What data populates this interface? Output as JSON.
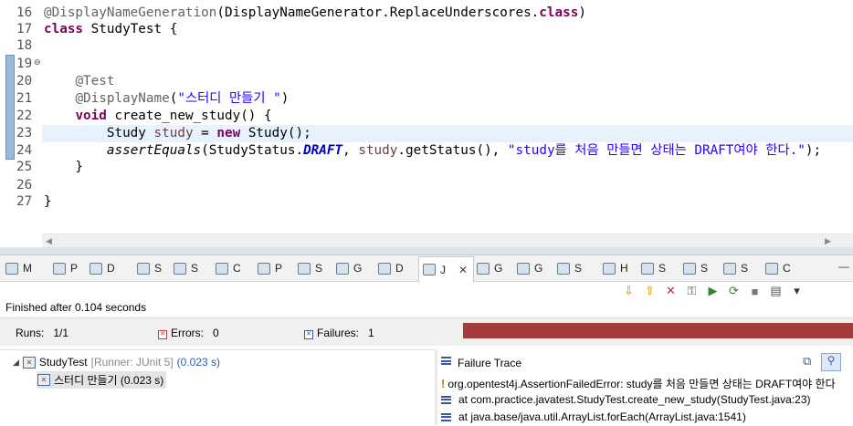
{
  "editor": {
    "lines": [
      {
        "n": "16",
        "tokens": [
          [
            "ann",
            "@DisplayNameGeneration"
          ],
          [
            "",
            "(DisplayNameGenerator.ReplaceUnderscores."
          ],
          [
            "kw",
            "class"
          ],
          [
            "",
            ")"
          ]
        ]
      },
      {
        "n": "17",
        "tokens": [
          [
            "kw",
            "class"
          ],
          [
            "",
            " StudyTest {"
          ]
        ]
      },
      {
        "n": "18",
        "tokens": []
      },
      {
        "n": "19",
        "tokens": [],
        "fold": "⊖"
      },
      {
        "n": "20",
        "tokens": [
          [
            "",
            "    "
          ],
          [
            "ann",
            "@Test"
          ]
        ]
      },
      {
        "n": "21",
        "tokens": [
          [
            "",
            "    "
          ],
          [
            "ann",
            "@DisplayName"
          ],
          [
            "",
            "("
          ],
          [
            "str",
            "\"스터디 만들기 \""
          ],
          [
            "",
            ")"
          ]
        ]
      },
      {
        "n": "22",
        "tokens": [
          [
            "",
            "    "
          ],
          [
            "kw",
            "void"
          ],
          [
            "",
            " create_new_study() {"
          ]
        ]
      },
      {
        "n": "23",
        "tokens": [
          [
            "",
            "        Study "
          ],
          [
            "var",
            "study"
          ],
          [
            "",
            " = "
          ],
          [
            "kw",
            "new"
          ],
          [
            "",
            " Study();"
          ]
        ]
      },
      {
        "n": "24",
        "tokens": [
          [
            "",
            "        "
          ],
          [
            "stat",
            "assertEquals"
          ],
          [
            "",
            "(StudyStatus."
          ],
          [
            "fld",
            "DRAFT"
          ],
          [
            "",
            ", "
          ],
          [
            "var",
            "study"
          ],
          [
            "",
            ".getStatus(), "
          ],
          [
            "str",
            "\"study를 처음 만들면 상태는 DRAFT여야 한다.\""
          ],
          [
            "",
            ");"
          ]
        ]
      },
      {
        "n": "25",
        "tokens": [
          [
            "",
            "    }"
          ]
        ]
      },
      {
        "n": "26",
        "tokens": []
      },
      {
        "n": "27",
        "tokens": [
          [
            "",
            "}"
          ]
        ]
      },
      {
        "n": "",
        "tokens": []
      }
    ]
  },
  "views": {
    "tabs": [
      {
        "label": "M",
        "icon": "markers-icon"
      },
      {
        "label": "P",
        "icon": "properties-icon"
      },
      {
        "label": "D",
        "icon": "data-source-icon"
      },
      {
        "label": "S",
        "icon": "snippets-icon"
      },
      {
        "label": "S",
        "icon": "search-icon"
      },
      {
        "label": "C",
        "icon": "console-icon"
      },
      {
        "label": "P",
        "icon": "progress-icon"
      },
      {
        "label": "S",
        "icon": "servers-icon"
      },
      {
        "label": "G",
        "icon": "gradle-tasks-icon"
      },
      {
        "label": "D",
        "icon": "debug-icon"
      },
      {
        "label": "J",
        "icon": "junit-icon",
        "active": true,
        "close": "✕"
      },
      {
        "label": "G",
        "icon": "gradle-icon"
      },
      {
        "label": "G",
        "icon": "gradle-executions-icon"
      },
      {
        "label": "S",
        "icon": "sql-results-icon"
      },
      {
        "label": "H",
        "icon": "history-icon"
      },
      {
        "label": "S",
        "icon": "stop-icon"
      },
      {
        "label": "S",
        "icon": "spring-icon"
      },
      {
        "label": "S",
        "icon": "support-icon"
      },
      {
        "label": "C",
        "icon": "coverage-icon"
      }
    ]
  },
  "junit": {
    "finished": "Finished after 0.104 seconds",
    "runs_label": "Runs:",
    "runs_value": "1/1",
    "errors_label": "Errors:",
    "errors_value": "0",
    "failures_label": "Failures:",
    "failures_value": "1",
    "progress_color": "#a33b3b",
    "progress_fraction": 1.0,
    "tree": {
      "root_label": "StudyTest",
      "root_runner": "[Runner: JUnit 5]",
      "root_time": "(0.023 s)",
      "child_label": "스터디 만들기 (0.023 s)"
    },
    "trace": {
      "title": "Failure Trace",
      "lines": [
        "org.opentest4j.AssertionFailedError: study를 처음 만들면 상태는 DRAFT여야 한다",
        "at com.practice.javatest.StudyTest.create_new_study(StudyTest.java:23)",
        "at java.base/java.util.ArrayList.forEach(ArrayList.java:1541)"
      ]
    }
  }
}
